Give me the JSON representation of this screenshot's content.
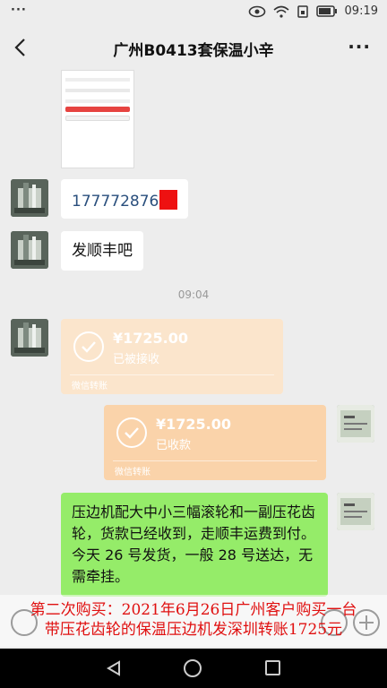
{
  "status_bar": {
    "dots": "···",
    "time": "09:19"
  },
  "header": {
    "title": "广州B0413套保温小辛",
    "more": "···"
  },
  "messages": {
    "phone_text": "177772876",
    "reply_text": "发顺丰吧",
    "time_separator": "09:04",
    "transfer_received": {
      "amount": "¥1725.00",
      "status": "已被接收",
      "footer": "微信转账"
    },
    "transfer_confirmed": {
      "amount": "¥1725.00",
      "status": "已收款",
      "footer": "微信转账"
    },
    "green_message": "压边机配大中小三幅滚轮和一副压花齿轮，货款已经收到，走顺丰运费到付。今天 26 号发货，一般 28 号送达，无需牵挂。"
  },
  "overlay": {
    "line1": "第二次购买：2021年6月26日广州客户购买一台",
    "line2": "带压花齿轮的保温压边机发深圳转账1725元"
  },
  "colors": {
    "background": "#ededed",
    "green_bubble": "#95ec69",
    "transfer": "#fad3aa",
    "overlay_text": "#e01010"
  }
}
